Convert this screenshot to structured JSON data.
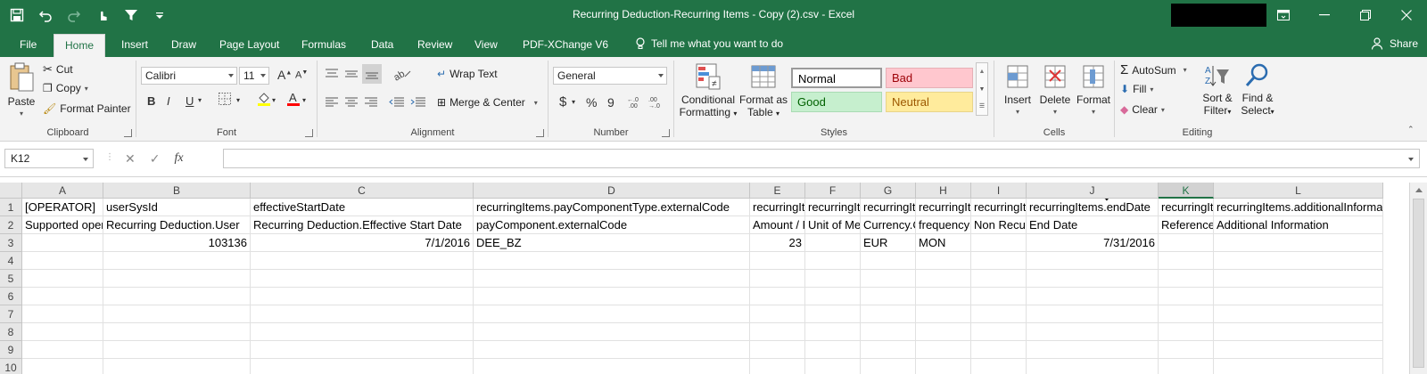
{
  "window": {
    "title": "Recurring Deduction-Recurring Items - Copy (2).csv  -  Excel"
  },
  "ribbon_tabs": [
    {
      "label": "File"
    },
    {
      "label": "Home"
    },
    {
      "label": "Insert"
    },
    {
      "label": "Draw"
    },
    {
      "label": "Page Layout"
    },
    {
      "label": "Formulas"
    },
    {
      "label": "Data"
    },
    {
      "label": "Review"
    },
    {
      "label": "View"
    },
    {
      "label": "PDF-XChange V6"
    }
  ],
  "tell_me": "Tell me what you want to do",
  "share": "Share",
  "clipboard": {
    "paste": "Paste",
    "cut": "Cut",
    "copy": "Copy",
    "format_painter": "Format Painter",
    "label": "Clipboard"
  },
  "font": {
    "name": "Calibri",
    "size": "11",
    "grow": "A",
    "shrink": "A",
    "bold": "B",
    "italic": "I",
    "underline": "U",
    "label": "Font"
  },
  "alignment": {
    "wrap_text": "Wrap Text",
    "merge_center": "Merge & Center",
    "label": "Alignment"
  },
  "number": {
    "format": "General",
    "currency": "$",
    "percent": "%",
    "comma": "9",
    "label": "Number"
  },
  "styles": {
    "conditional": [
      "Conditional",
      "Formatting"
    ],
    "format_table": [
      "Format as",
      "Table"
    ],
    "normal": "Normal",
    "bad": "Bad",
    "good": "Good",
    "neutral": "Neutral",
    "label": "Styles",
    "colors": {
      "bad_bg": "#ffc7ce",
      "bad_fg": "#9c0006",
      "good_bg": "#c6efce",
      "good_fg": "#006100",
      "neutral_bg": "#ffeb9c",
      "neutral_fg": "#9c5700"
    }
  },
  "cells_group": {
    "insert": "Insert",
    "delete": "Delete",
    "format": "Format",
    "label": "Cells"
  },
  "editing": {
    "autosum": "AutoSum",
    "fill": "Fill",
    "clear": "Clear",
    "sort_filter": [
      "Sort &",
      "Filter"
    ],
    "find_select": [
      "Find &",
      "Select"
    ],
    "label": "Editing"
  },
  "formula_bar": {
    "name_box": "K12",
    "fx": "fx",
    "formula": ""
  },
  "grid": {
    "columns": [
      "A",
      "B",
      "C",
      "D",
      "E",
      "F",
      "G",
      "H",
      "I",
      "J",
      "K",
      "L"
    ],
    "selected_column": "K",
    "rows": [
      "1",
      "2",
      "3",
      "4",
      "5",
      "6",
      "7",
      "8",
      "9",
      "10"
    ],
    "cells": [
      [
        "[OPERATOR]",
        "userSysId",
        "effectiveStartDate",
        "recurringItems.payComponentType.externalCode",
        "recurringItems.amount",
        "recurringItems.unitOfMeasure",
        "recurringItems.currencyCode",
        "recurringItems.frequency",
        "recurringItems.nonRecurring",
        "recurringItems.endDate",
        "recurringItems.referenceId",
        "recurringItems.additionalInformation"
      ],
      [
        "Supported operators",
        "Recurring Deduction.User",
        "Recurring Deduction.Effective Start Date",
        "payComponent.externalCode",
        "Amount / Percentage",
        "Unit of Measure",
        "Currency.Code",
        "frequency",
        "Non Recurring",
        "End Date",
        "Reference",
        "Additional Information"
      ],
      [
        "",
        "103136",
        "7/1/2016",
        "DEE_BZ",
        "23",
        "",
        "EUR",
        "MON",
        "",
        "7/31/2016",
        "",
        ""
      ]
    ]
  }
}
